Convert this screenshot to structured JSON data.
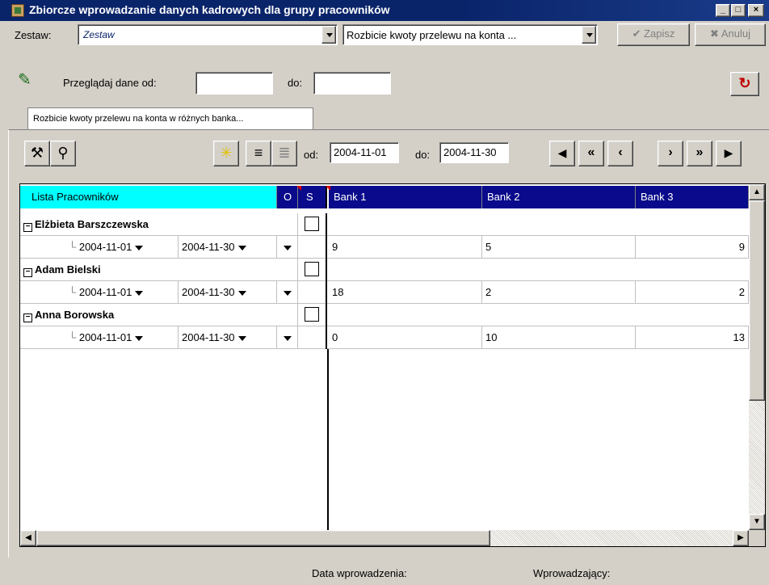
{
  "window": {
    "title": "Zbiorcze wprowadzanie danych kadrowych dla grupy pracowników",
    "minimize": "_",
    "maximize": "□",
    "close": "×"
  },
  "top": {
    "zestaw_label": "Zestaw:",
    "zestaw_value": "Zestaw",
    "type_value": "Rozbicie kwoty przelewu na konta ...",
    "zapisz": "✔ Zapisz",
    "anuluj": "✖ Anuluj"
  },
  "filter": {
    "od_label": "Przeglądaj dane od:",
    "od_value": "",
    "do_label": "do:",
    "do_value": ""
  },
  "tab": {
    "label": "Rozbicie kwoty przelewu na konta w różnych banka..."
  },
  "toolbar": {
    "od_label": "od:",
    "od_value": "2004-11-01",
    "do_label": "do:",
    "do_value": "2004-11-30"
  },
  "grid": {
    "headers": {
      "list": "Lista Pracowników",
      "o": "O",
      "s": "S",
      "bank1": "Bank 1",
      "bank2": "Bank 2",
      "bank3": "Bank 3"
    },
    "employees": [
      {
        "name": "Elżbieta Barszczewska",
        "from": "2004-11-01",
        "to": "2004-11-30",
        "bank1": "9",
        "bank2": "5",
        "bank3": "9"
      },
      {
        "name": "Adam Bielski",
        "from": "2004-11-01",
        "to": "2004-11-30",
        "bank1": "18",
        "bank2": "2",
        "bank3": "2"
      },
      {
        "name": "Anna Borowska",
        "from": "2004-11-01",
        "to": "2004-11-30",
        "bank1": "0",
        "bank2": "10",
        "bank3": "13"
      }
    ]
  },
  "status": {
    "data_label": "Data wprowadzenia:",
    "wprow_label": "Wprowadzający:"
  },
  "colors": {
    "title_bar": "#0a246a",
    "header_blue": "#0a0a8c",
    "header_cyan": "#00ffff",
    "face": "#d4d0c8"
  }
}
